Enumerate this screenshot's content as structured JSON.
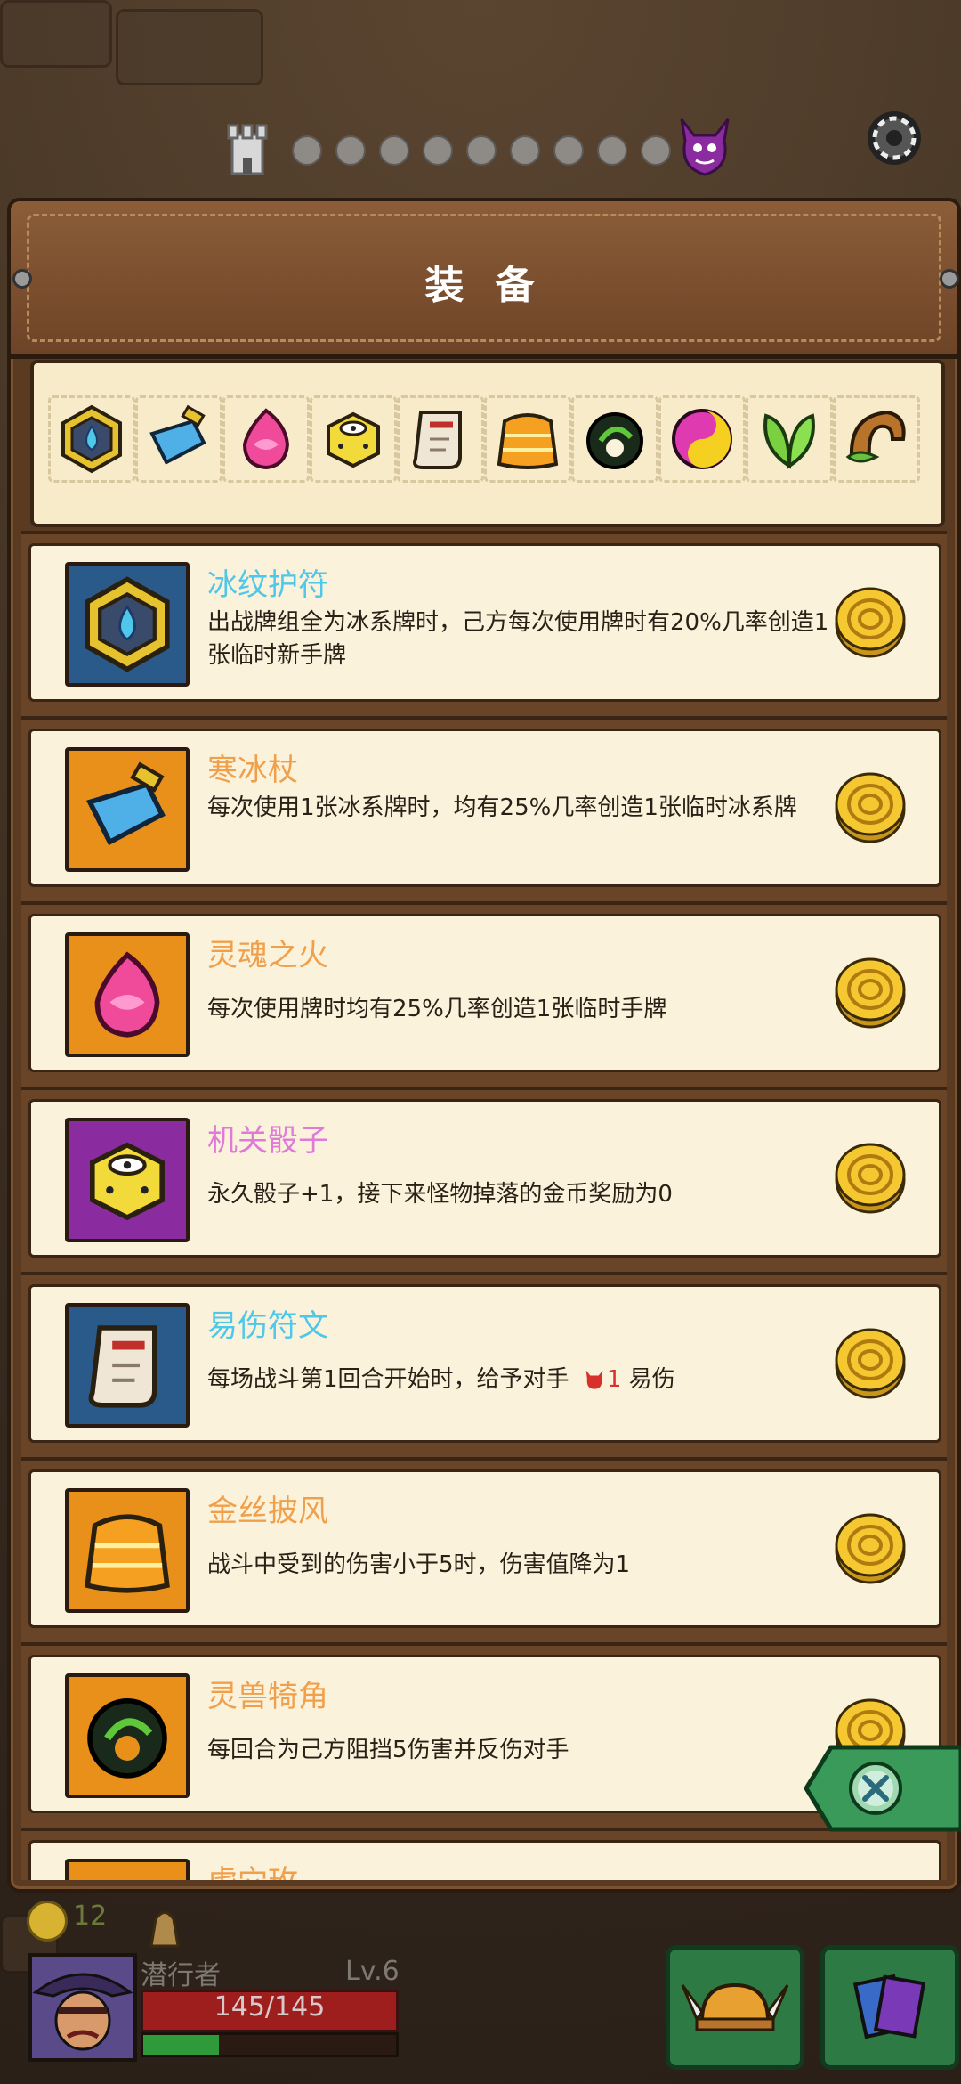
{
  "header": {
    "title": "装 备"
  },
  "colors": {
    "ice": "#4fc7e8",
    "fire": "#f0a04b",
    "special": "#e07ad8",
    "blue_bg": "#2a5a8a",
    "orange_bg": "#e8901a",
    "purple_bg": "#8a2ca0"
  },
  "strip_icons": [
    "hex-amulet-icon",
    "ice-staff-icon",
    "soul-fire-icon",
    "mech-dice-icon",
    "scroll-icon",
    "golden-cape-icon",
    "beast-horn-icon",
    "yin-yang-orb-icon",
    "leaf-icon",
    "horn-plant-icon"
  ],
  "items": [
    {
      "name": "冰纹护符",
      "color": "#4fc7e8",
      "bg": "#2a5a8a",
      "icon": "hex-amulet-icon",
      "desc": "出战牌组全为冰系牌时，己方每次使用牌时有20%几率创造1张临时新手牌"
    },
    {
      "name": "寒冰杖",
      "color": "#f0a04b",
      "bg": "#e8901a",
      "icon": "ice-staff-icon",
      "desc": "每次使用1张冰系牌时，均有25%几率创造1张临时冰系牌"
    },
    {
      "name": "灵魂之火",
      "color": "#f0a04b",
      "bg": "#e8901a",
      "icon": "soul-fire-icon",
      "desc": "每次使用牌时均有25%几率创造1张临时手牌"
    },
    {
      "name": "机关骰子",
      "color": "#e07ad8",
      "bg": "#8a2ca0",
      "icon": "mech-dice-icon",
      "desc": "永久骰子+1，接下来怪物掉落的金币奖励为0"
    },
    {
      "name": "易伤符文",
      "color": "#4fc7e8",
      "bg": "#2a5a8a",
      "icon": "scroll-icon",
      "desc_before": "每场战斗第1回合开始时，给予对手",
      "desc_num": "1",
      "desc_after": "易伤"
    },
    {
      "name": "金丝披风",
      "color": "#f0a04b",
      "bg": "#e8901a",
      "icon": "golden-cape-icon",
      "desc": "战斗中受到的伤害小于5时，伤害值降为1"
    },
    {
      "name": "灵兽犄角",
      "color": "#f0a04b",
      "bg": "#e8901a",
      "icon": "beast-horn-icon",
      "desc": "每回合为己方阻挡5伤害并反伤对手"
    },
    {
      "name": "虎穴玫",
      "color": "#f0a04b",
      "bg": "#e8901a",
      "icon": "partial-item-icon",
      "desc": ""
    }
  ],
  "hud": {
    "gold": "12",
    "player_name": "潜行者",
    "level": "Lv.6",
    "hp": "145/145",
    "hp_fraction": 1.0,
    "xp_fraction": 0.3
  }
}
